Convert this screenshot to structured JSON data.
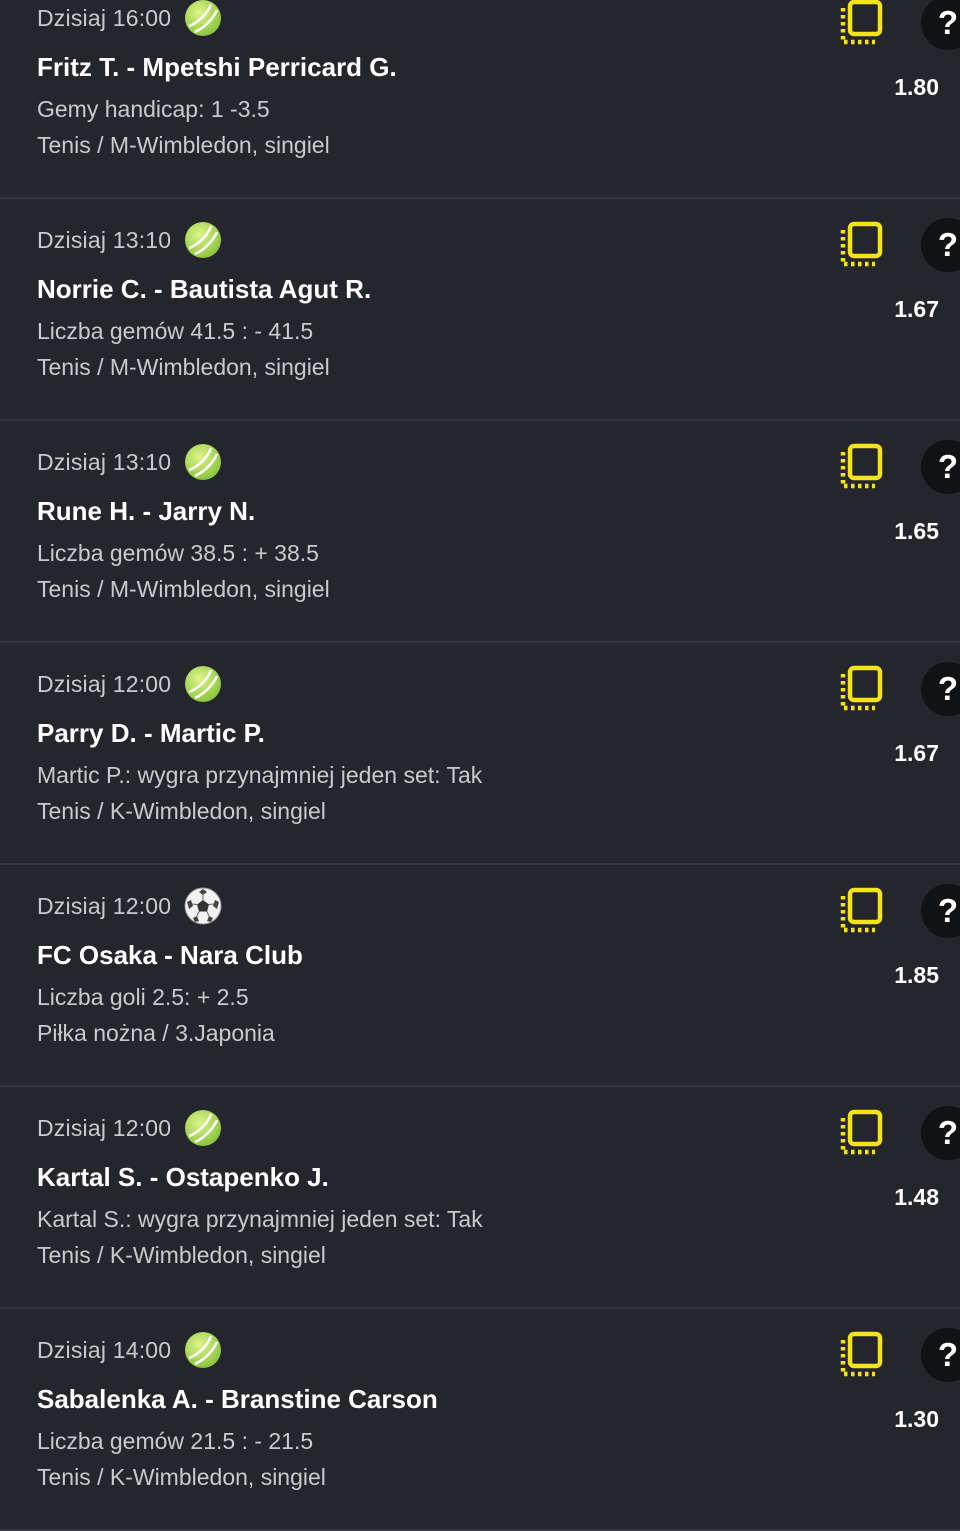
{
  "colors": {
    "background": "#24262b",
    "accent": "#f5e31a",
    "muted_text": "#c9cacd",
    "divider": "#34363c"
  },
  "bets": [
    {
      "time": "Dzisiaj 16:00",
      "sport_icon": "tennis-ball-icon",
      "match": "Fritz T. - Mpetshi Perricard G.",
      "market": "Gemy handicap: 1 -3.5",
      "league": "Tenis / M-Wimbledon, singiel",
      "odds": "1.80",
      "help": "?"
    },
    {
      "time": "Dzisiaj 13:10",
      "sport_icon": "tennis-ball-icon",
      "match": "Norrie C. - Bautista Agut R.",
      "market": "Liczba gemów 41.5 : - 41.5",
      "league": "Tenis / M-Wimbledon, singiel",
      "odds": "1.67",
      "help": "?"
    },
    {
      "time": "Dzisiaj 13:10",
      "sport_icon": "tennis-ball-icon",
      "match": "Rune H. - Jarry N.",
      "market": "Liczba gemów 38.5 : + 38.5",
      "league": "Tenis / M-Wimbledon, singiel",
      "odds": "1.65",
      "help": "?"
    },
    {
      "time": "Dzisiaj 12:00",
      "sport_icon": "tennis-ball-icon",
      "match": "Parry D. - Martic P.",
      "market": "Martic P.: wygra przynajmniej jeden set: Tak",
      "league": "Tenis / K-Wimbledon, singiel",
      "odds": "1.67",
      "help": "?"
    },
    {
      "time": "Dzisiaj 12:00",
      "sport_icon": "soccer-ball-icon",
      "match": "FC Osaka - Nara Club",
      "market": "Liczba goli 2.5: + 2.5",
      "league": "Piłka nożna / 3.Japonia",
      "odds": "1.85",
      "help": "?"
    },
    {
      "time": "Dzisiaj 12:00",
      "sport_icon": "tennis-ball-icon",
      "match": "Kartal S. - Ostapenko J.",
      "market": "Kartal S.: wygra przynajmniej jeden set: Tak",
      "league": "Tenis / K-Wimbledon, singiel",
      "odds": "1.48",
      "help": "?"
    },
    {
      "time": "Dzisiaj 14:00",
      "sport_icon": "tennis-ball-icon",
      "match": "Sabalenka A. - Branstine Carson",
      "market": "Liczba gemów 21.5 : - 21.5",
      "league": "Tenis / K-Wimbledon, singiel",
      "odds": "1.30",
      "help": "?"
    }
  ]
}
